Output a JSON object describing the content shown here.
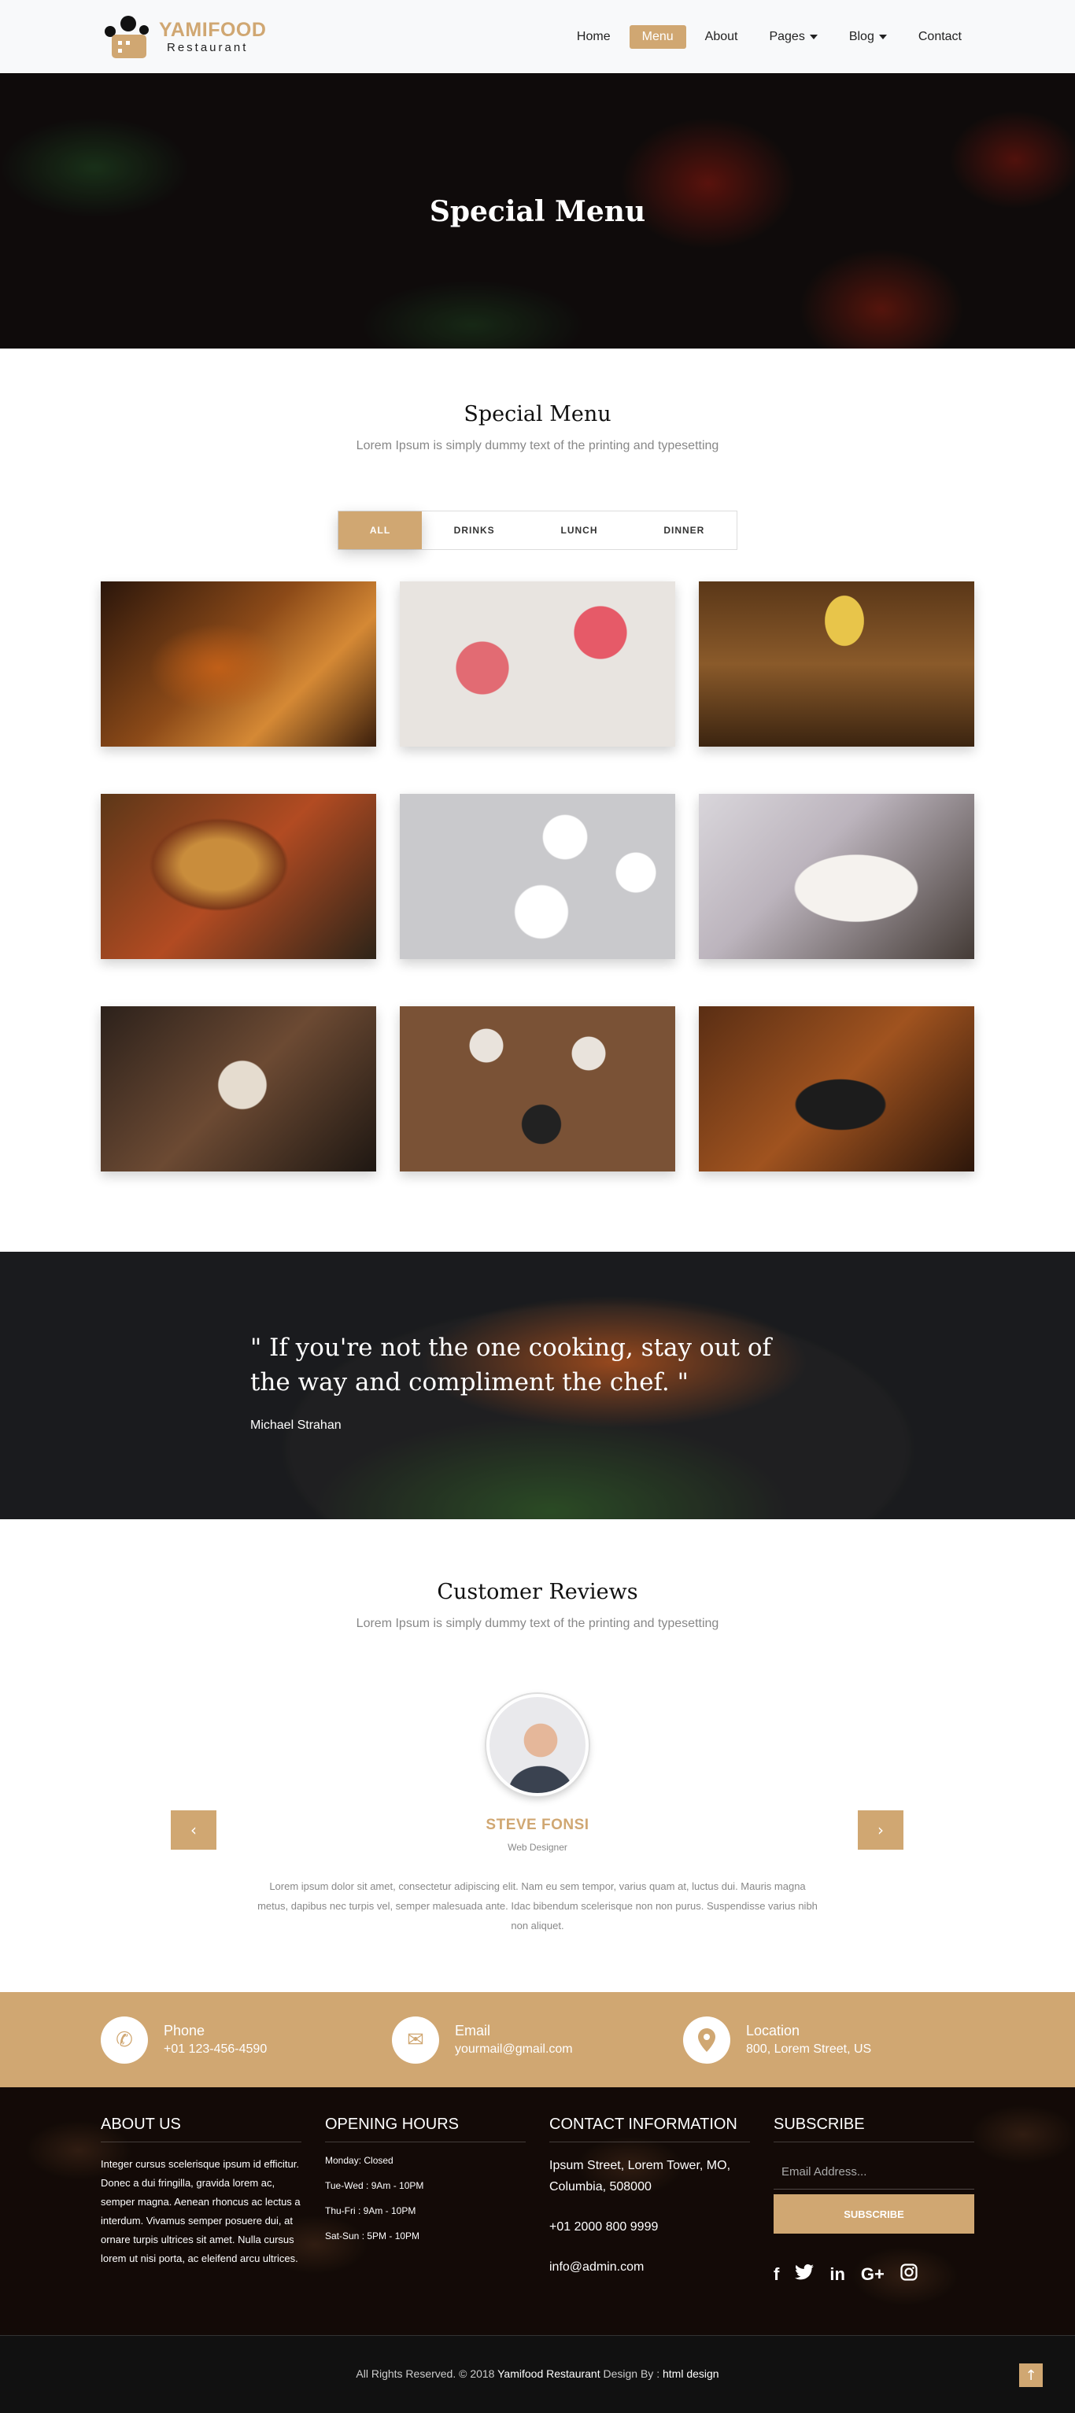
{
  "brand": {
    "name": "YAMIFOOD",
    "tagline": "Restaurant",
    "color": "#d0a772"
  },
  "nav": {
    "items": [
      {
        "label": "Home",
        "active": false
      },
      {
        "label": "Menu",
        "active": true
      },
      {
        "label": "About",
        "active": false
      },
      {
        "label": "Pages",
        "active": false,
        "dropdown": true
      },
      {
        "label": "Blog",
        "active": false,
        "dropdown": true
      },
      {
        "label": "Contact",
        "active": false
      }
    ]
  },
  "hero": {
    "title": "Special Menu"
  },
  "menu": {
    "title": "Special Menu",
    "subtitle": "Lorem Ipsum is simply dummy text of the printing and typesetting",
    "filters": [
      {
        "label": "ALL",
        "active": true
      },
      {
        "label": "DRINKS",
        "active": false
      },
      {
        "label": "LUNCH",
        "active": false
      },
      {
        "label": "DINNER",
        "active": false
      }
    ],
    "gallery": [
      "cocktail-glass-image",
      "pink-drinks-image",
      "beer-glass-image",
      "burger-image",
      "salad-plates-image",
      "salmon-plate-image",
      "dining-table-image",
      "korean-dishes-image",
      "skillet-dish-image"
    ]
  },
  "quote": {
    "text": "\" If you're not the one cooking, stay out of the way and compliment the chef. \"",
    "author": "Michael Strahan"
  },
  "reviews": {
    "title": "Customer Reviews",
    "subtitle": "Lorem Ipsum is simply dummy text of the printing and typesetting",
    "name": "STEVE FONSI",
    "role": "Web Designer",
    "text": "Lorem ipsum dolor sit amet, consectetur adipiscing elit. Nam eu sem tempor, varius quam at, luctus dui. Mauris magna metus, dapibus nec turpis vel, semper malesuada ante. Idac bibendum scelerisque non non purus. Suspendisse varius nibh non aliquet."
  },
  "contact_strip": {
    "phone": {
      "label": "Phone",
      "value": "+01 123-456-4590"
    },
    "email": {
      "label": "Email",
      "value": "yourmail@gmail.com"
    },
    "location": {
      "label": "Location",
      "value": "800, Lorem Street, US"
    }
  },
  "footer": {
    "about_title": "ABOUT US",
    "about_text": "Integer cursus scelerisque ipsum id efficitur. Donec a dui fringilla, gravida lorem ac, semper magna. Aenean rhoncus ac lectus a interdum. Vivamus semper posuere dui, at ornare turpis ultrices sit amet. Nulla cursus lorem ut nisi porta, ac eleifend arcu ultrices.",
    "hours_title": "OPENING HOURS",
    "hours": [
      "Monday: Closed",
      "Tue-Wed : 9Am - 10PM",
      "Thu-Fri : 9Am - 10PM",
      "Sat-Sun : 5PM - 10PM"
    ],
    "contact_title": "CONTACT INFORMATION",
    "address": "Ipsum Street, Lorem Tower, MO, Columbia, 508000",
    "phone": "+01 2000 800 9999",
    "email": "info@admin.com",
    "subscribe_title": "SUBSCRIBE",
    "subscribe_placeholder": "Email Address...",
    "subscribe_button": "SUBSCRIBE",
    "socials": [
      "facebook-icon",
      "twitter-icon",
      "linkedin-icon",
      "google-plus-icon",
      "instagram-icon"
    ]
  },
  "copyright": {
    "prefix": "All Rights Reserved. © 2018",
    "company": "Yamifood Restaurant",
    "design_by": "Design By :",
    "designer": "html design"
  }
}
